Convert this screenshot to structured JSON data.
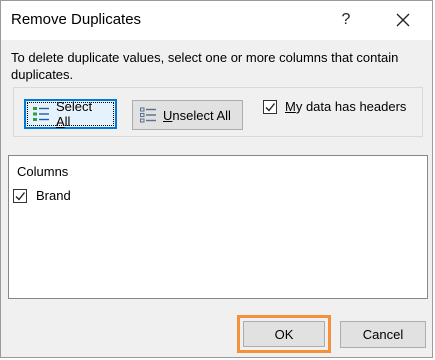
{
  "dialog": {
    "title": "Remove Duplicates",
    "help_glyph": "?",
    "description": "To delete duplicate values, select one or more columns that contain duplicates."
  },
  "actions": {
    "select_all": {
      "prefix": "Select ",
      "accel": "A",
      "suffix": "ll"
    },
    "unselect_all": {
      "accel": "U",
      "suffix": "nselect All"
    },
    "headers_checkbox": {
      "prefix": "",
      "accel": "M",
      "suffix": "y data has headers",
      "checked": true
    }
  },
  "columns": {
    "header": "Columns",
    "items": [
      {
        "label": "Brand",
        "checked": true
      }
    ]
  },
  "footer": {
    "ok_label": "OK",
    "cancel_label": "Cancel",
    "highlight_color": "#f5913a"
  },
  "icons": {
    "help": "question-mark-icon",
    "close": "close-icon",
    "select_all": "select-all-list-icon",
    "unselect_all": "unselect-all-list-icon",
    "check": "checkmark-icon"
  }
}
